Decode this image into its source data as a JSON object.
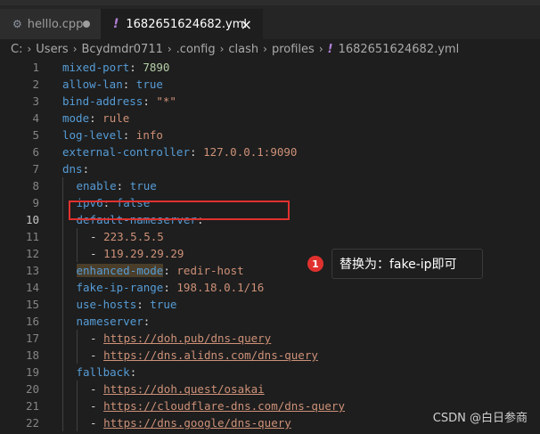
{
  "tabs": [
    {
      "label": "helllo.cpp",
      "active": false,
      "icon": "cpp-file-icon",
      "dirty": true
    },
    {
      "label": "1682651624682.yml",
      "active": true,
      "icon": "yaml-file-icon"
    }
  ],
  "breadcrumb": [
    "C:",
    "Users",
    "Bcydmdr0711",
    ".config",
    "clash",
    "profiles",
    "1682651624682.yml"
  ],
  "editor": {
    "current_line": 10,
    "lines": [
      {
        "n": "1",
        "k": "mixed-port",
        "v": "7890",
        "t": "num",
        "i": 0
      },
      {
        "n": "2",
        "k": "allow-lan",
        "v": "true",
        "t": "bool",
        "i": 0
      },
      {
        "n": "3",
        "k": "bind-address",
        "v": "\"*\"",
        "t": "str",
        "i": 0
      },
      {
        "n": "4",
        "k": "mode",
        "v": "rule",
        "t": "str",
        "i": 0
      },
      {
        "n": "5",
        "k": "log-level",
        "v": "info",
        "t": "str",
        "i": 0
      },
      {
        "n": "6",
        "k": "external-controller",
        "v": "127.0.0.1:9090",
        "t": "str",
        "i": 0
      },
      {
        "n": "7",
        "k": "dns",
        "v": "",
        "t": "",
        "i": 0
      },
      {
        "n": "8",
        "k": "enable",
        "v": "true",
        "t": "bool",
        "i": 1
      },
      {
        "n": "9",
        "k": "ipv6",
        "v": "false",
        "t": "bool",
        "i": 1
      },
      {
        "n": "10",
        "k": "default-nameserver",
        "v": "",
        "t": "",
        "i": 1
      },
      {
        "n": "11",
        "d": "223.5.5.5",
        "t": "str",
        "i": 2
      },
      {
        "n": "12",
        "d": "119.29.29.29",
        "t": "str",
        "i": 2
      },
      {
        "n": "13",
        "k": "enhanced-mode",
        "v": "redir-host",
        "t": "str",
        "i": 1,
        "hl": true
      },
      {
        "n": "14",
        "k": "fake-ip-range",
        "v": "198.18.0.1/16",
        "t": "str",
        "i": 1
      },
      {
        "n": "15",
        "k": "use-hosts",
        "v": "true",
        "t": "bool",
        "i": 1
      },
      {
        "n": "16",
        "k": "nameserver",
        "v": "",
        "t": "",
        "i": 1
      },
      {
        "n": "17",
        "d": "https://doh.pub/dns-query",
        "t": "link",
        "i": 2
      },
      {
        "n": "18",
        "d": "https://dns.alidns.com/dns-query",
        "t": "link",
        "i": 2
      },
      {
        "n": "19",
        "k": "fallback",
        "v": "",
        "t": "",
        "i": 1
      },
      {
        "n": "20",
        "d": "https://doh.quest/osakai",
        "t": "link",
        "i": 2
      },
      {
        "n": "21",
        "d": "https://cloudflare-dns.com/dns-query",
        "t": "link",
        "i": 2
      },
      {
        "n": "22",
        "d": "https://dns.google/dns-query",
        "t": "link",
        "i": 2
      }
    ]
  },
  "annotation": {
    "badge": "1",
    "text": "替换为：fake-ip即可"
  },
  "watermark": "CSDN @白日参商",
  "colors": {
    "highlight_box": "#e0312e",
    "key": "#569cd6",
    "string": "#ce9178",
    "number": "#b5cea8"
  }
}
